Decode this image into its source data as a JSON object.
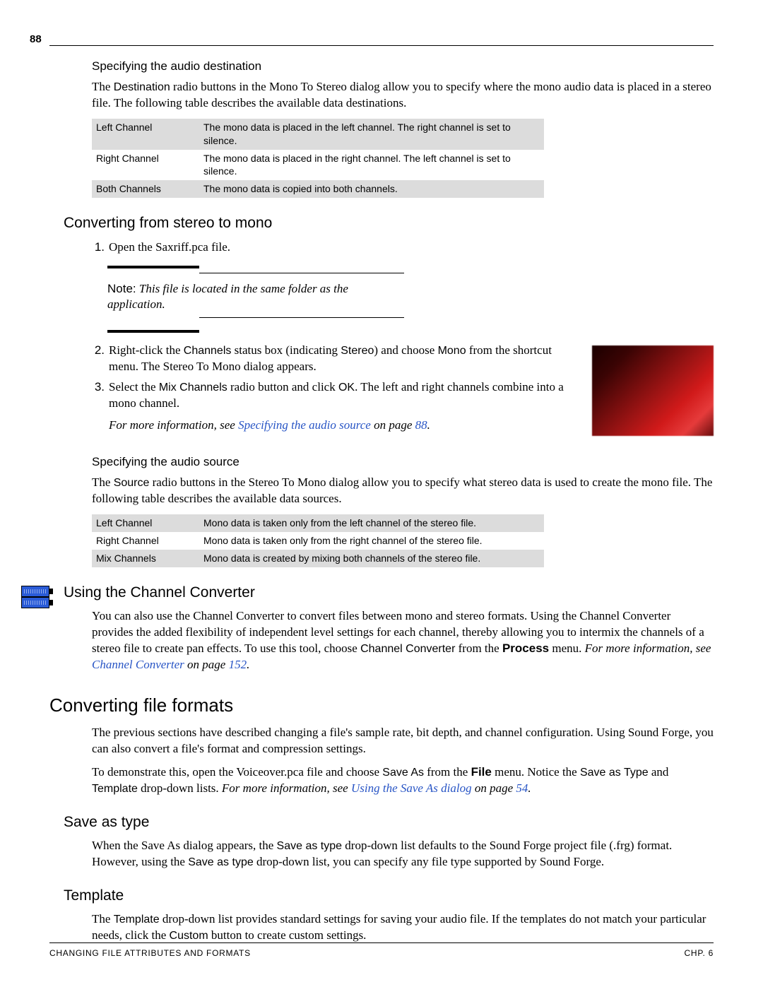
{
  "page_number": "88",
  "footer": {
    "left": "CHANGING FILE ATTRIBUTES AND FORMATS",
    "right": "CHP. 6"
  },
  "spec_dest": {
    "heading": "Specifying the audio destination",
    "para_a": "The ",
    "ui1": "Destination",
    "para_b": " radio buttons in the Mono To Stereo dialog allow you to specify where the mono audio data is placed in a stereo file. The following table describes the available data destinations.",
    "rows": [
      [
        "Left Channel",
        "The mono data is placed in the left channel. The right channel is set to silence."
      ],
      [
        "Right Channel",
        "The mono data is placed in the right channel. The left channel is set to silence."
      ],
      [
        "Both Channels",
        "The mono data is copied into both channels."
      ]
    ]
  },
  "stereo_to_mono": {
    "heading": "Converting from stereo to mono",
    "step1": {
      "n": "1.",
      "a": "Open the ",
      "file": "Saxriff.pca",
      "b": " file."
    },
    "note": {
      "label": "Note:",
      "text": "This file is located in the same folder as the application."
    },
    "step2": {
      "n": "2.",
      "a": "Right-click the ",
      "ui1": "Channels",
      "b": " status box (indicating ",
      "ui2": "Stereo",
      "c": ") and choose ",
      "ui3": "Mono",
      "d": " from the shortcut menu. The Stereo To Mono dialog appears."
    },
    "step3": {
      "n": "3.",
      "a": "Select the ",
      "ui1": "Mix Channels",
      "b": " radio button and click ",
      "ui2": "OK",
      "c": ". The left and right channels combine into a mono channel."
    },
    "xref": {
      "pre": "For more information, see ",
      "link": "Specifying the audio source",
      "mid": " on page ",
      "page": "88",
      "post": "."
    }
  },
  "spec_src": {
    "heading": "Specifying the audio source",
    "para_a": "The ",
    "ui1": "Source",
    "para_b": " radio buttons in the Stereo To Mono dialog allow you to specify what stereo data is used to create the mono file. The following table describes the available data sources.",
    "rows": [
      [
        "Left Channel",
        "Mono data is taken only from the left channel of the stereo file."
      ],
      [
        "Right Channel",
        "Mono data is taken only from the right channel of the stereo file."
      ],
      [
        "Mix Channels",
        "Mono data is created by mixing both channels of the stereo file."
      ]
    ]
  },
  "chan_conv": {
    "heading": "Using the Channel Converter",
    "para_a": "You can also use the Channel Converter to convert files between mono and stereo formats. Using the Channel Converter provides the added flexibility of independent level settings for each channel, thereby allowing you to intermix the channels of a stereo file to create pan effects. To use this tool, choose ",
    "ui1": "Channel Converter",
    "para_b": " from the ",
    "menu": "Process",
    "para_c": " menu. ",
    "xref": {
      "pre": "For more information, see ",
      "link": "Channel Converter",
      "mid": " on page ",
      "page": "152",
      "post": "."
    }
  },
  "convert_formats": {
    "heading": "Converting file formats",
    "p1": "The previous sections have described changing a file's sample rate, bit depth, and channel configuration. Using Sound Forge, you can also convert a file's format and compression settings.",
    "p2a": "To demonstrate this, open the ",
    "file": "Voiceover.pca",
    "p2b": " file and choose ",
    "ui1": "Save As",
    "p2c": " from the ",
    "menu": "File",
    "p2d": " menu. Notice the ",
    "ui2": "Save as Type",
    "p2e": " and ",
    "ui3": "Template",
    "p2f": " drop-down lists. ",
    "xref": {
      "pre": "For more information, see ",
      "link": "Using the Save As dialog",
      "mid": " on page ",
      "page": "54",
      "post": "."
    }
  },
  "save_as_type": {
    "heading": "Save as type",
    "para_a": "When the Save As dialog appears, the ",
    "ui1": "Save as type",
    "para_b": " drop-down list defaults to the Sound Forge project file (.frg) format. However, using the ",
    "ui2": "Save as type",
    "para_c": " drop-down list, you can specify any file type supported by Sound Forge."
  },
  "template": {
    "heading": "Template",
    "para_a": "The ",
    "ui1": "Template",
    "para_b": " drop-down list provides standard settings for saving your audio file. If the templates do not match your particular needs, click the ",
    "ui2": "Custom",
    "para_c": " button to create custom settings."
  }
}
